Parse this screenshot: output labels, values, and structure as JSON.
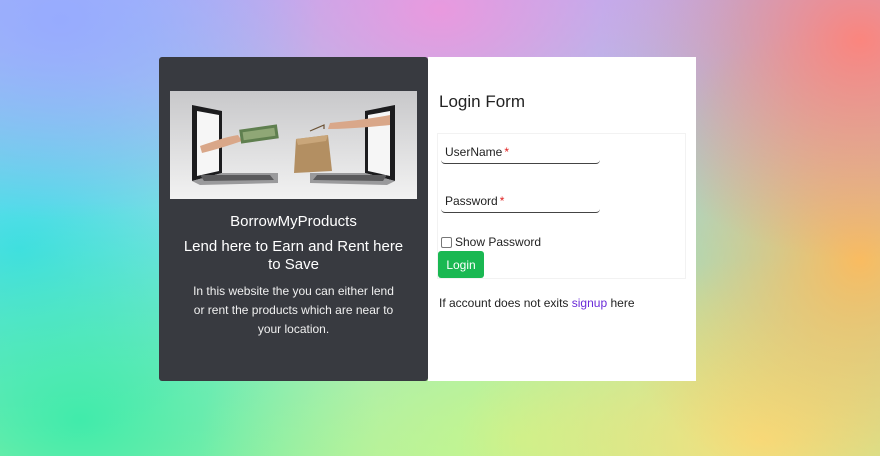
{
  "left_panel": {
    "brand": "BorrowMyProducts",
    "tagline": "Lend here to Earn and Rent here to Save",
    "description": "In this website the you can either lend or rent the products which are near to your location."
  },
  "form": {
    "title": "Login Form",
    "username_label": "UserName",
    "password_label": "Password",
    "required_mark": "*",
    "show_password_label": "Show Password",
    "show_password_checked": false,
    "login_button": "Login"
  },
  "signup": {
    "prefix": "If account does not exits",
    "link": "signup",
    "suffix": "here"
  },
  "colors": {
    "panel_dark": "#383a40",
    "login_button": "#1ab852",
    "link": "#6a2bd8",
    "required": "#e02020"
  }
}
